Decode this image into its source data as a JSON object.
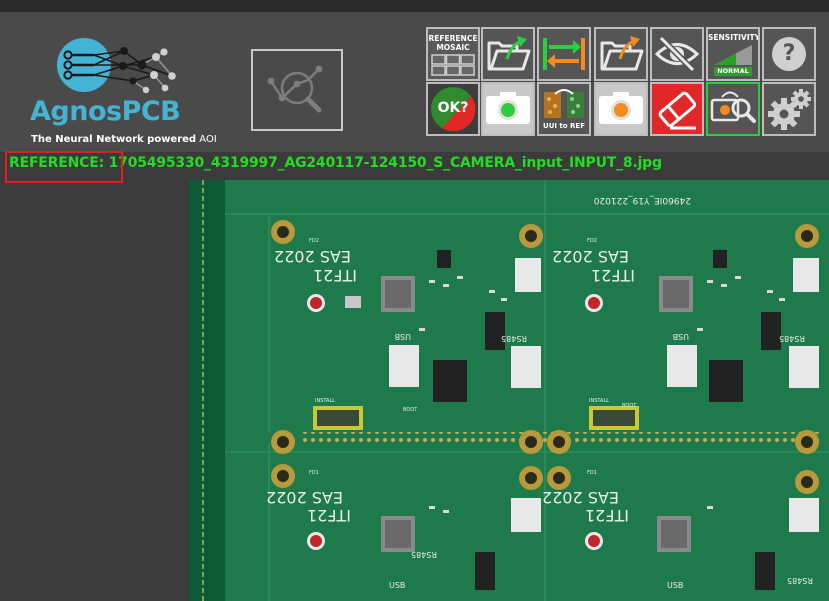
{
  "app": {
    "logo_name": "AgnosPCB",
    "logo_tagline_bold": "The Neural Network powered",
    "logo_tagline_rest": " AOI"
  },
  "toolbar": {
    "reference_mosaic_label": "REFERENCE\nMOSAIC",
    "sensitivity_label": "SENSITIVITY",
    "sensitivity_value": "NORMAL",
    "ok_label": "OK?",
    "uui_to_ref_label": "UUI to REF",
    "help_label": "?"
  },
  "viewer": {
    "reference_prefix": "REFERENCE:",
    "reference_filename": " 1705495330_4319997_AG240117-124150_S_CAMERA_input_INPUT_8.jpg",
    "board_code": "24960IE_Y19_221020",
    "board_names": [
      "ITF21",
      "EAS 2022"
    ],
    "component_labels": [
      "USB",
      "RS485",
      "BOOT",
      "INSTALL",
      "FD2",
      "FD1"
    ]
  },
  "colors": {
    "accent_blue": "#45b3d3",
    "ok_green": "#2e8b2e",
    "alert_red": "#e02828",
    "reference_text": "#22dd22",
    "pcb_green": "#1e7a4a"
  },
  "icons": [
    "search-analysis-icon",
    "grid-icon",
    "folder-upload-icon",
    "swap-arrows-icon",
    "folder-open-icon",
    "eye-off-icon",
    "sensitivity-ramp-icon",
    "help-icon",
    "camera-green-icon",
    "camera-swap-icon",
    "camera-orange-icon",
    "eraser-icon",
    "camera-search-icon",
    "gears-icon"
  ]
}
